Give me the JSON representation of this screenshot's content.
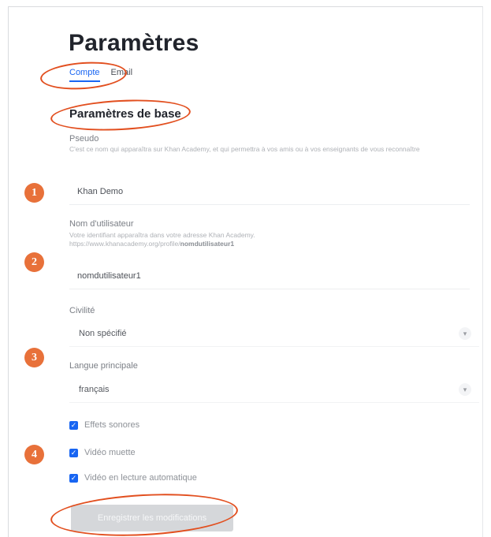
{
  "page": {
    "title": "Paramètres"
  },
  "tabs": [
    {
      "label": "Compte",
      "active": true
    },
    {
      "label": "Email",
      "active": false
    }
  ],
  "section": {
    "title": "Paramètres de base"
  },
  "pseudo": {
    "label": "Pseudo",
    "help": "C'est ce nom qui apparaîtra sur Khan Academy, et qui permettra à vos amis ou à vos enseignants de vous reconnaître",
    "value": "Khan Demo"
  },
  "username": {
    "label": "Nom d'utilisateur",
    "help_line1": "Votre identifiant apparaîtra dans votre adresse Khan Academy.",
    "help_line2_prefix": "https://www.khanacademy.org/profile/",
    "help_line2_bold": "nomdutilisateur1",
    "value": "nomdutilisateur1"
  },
  "civility": {
    "label": "Civilité",
    "value": "Non spécifié"
  },
  "language": {
    "label": "Langue principale",
    "value": "français"
  },
  "checkboxes": [
    {
      "label": "Effets sonores",
      "checked": true
    },
    {
      "label": "Vidéo muette",
      "checked": true
    },
    {
      "label": "Vidéo en lecture automatique",
      "checked": true
    }
  ],
  "save_button": {
    "label": "Enregistrer les modifications"
  },
  "markers": [
    "1",
    "2",
    "3",
    "4"
  ],
  "colors": {
    "accent": "#1865f2",
    "marker": "#e8713a",
    "annotation": "#e24f1f"
  }
}
